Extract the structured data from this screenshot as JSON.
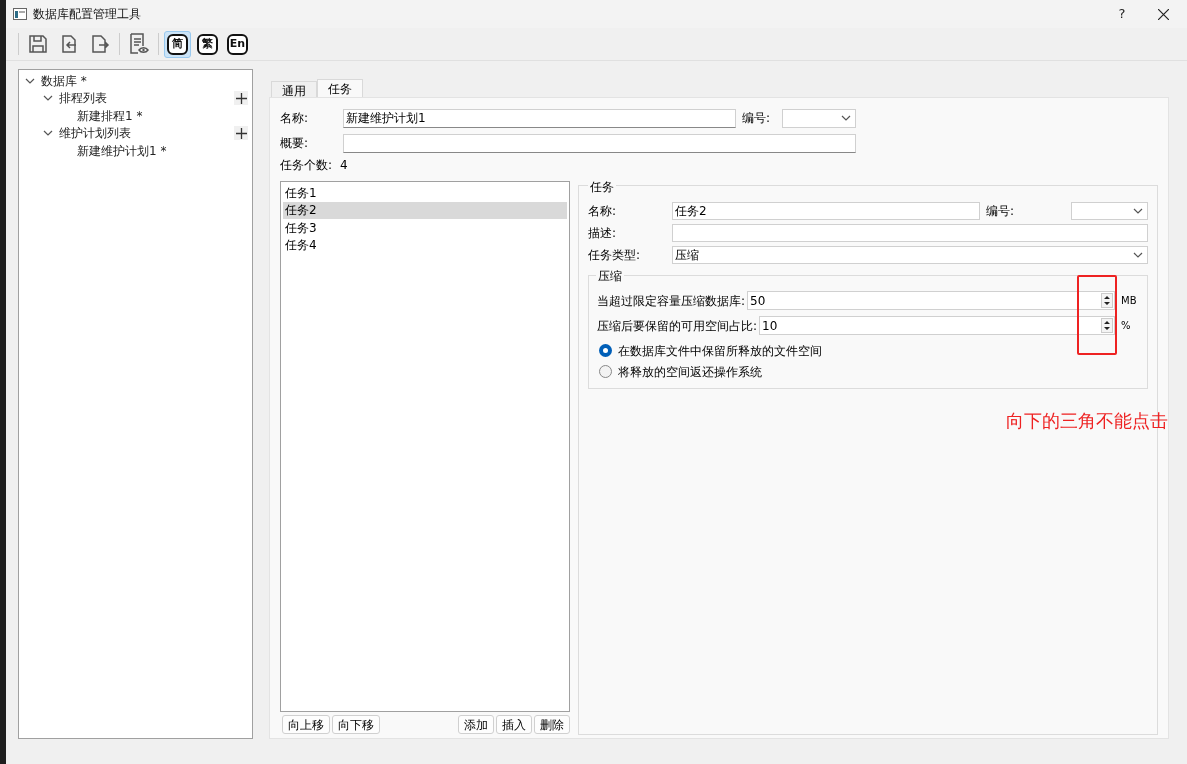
{
  "window": {
    "title": "数据库配置管理工具",
    "help": "?"
  },
  "toolbar": {
    "actions": [
      {
        "kind": "save"
      },
      {
        "kind": "import"
      },
      {
        "kind": "export"
      },
      {
        "kind": "preview"
      }
    ],
    "languages": [
      {
        "label": "简",
        "selected": true
      },
      {
        "label": "繁",
        "selected": false
      },
      {
        "label": "En",
        "selected": false
      }
    ]
  },
  "tree": [
    {
      "label": "数据库 *",
      "expanded": true,
      "addable": false,
      "children": [
        {
          "label": "排程列表",
          "expanded": true,
          "addable": true,
          "children": [
            {
              "label": "新建排程1 *",
              "addable": false
            }
          ]
        },
        {
          "label": "维护计划列表",
          "expanded": true,
          "addable": true,
          "children": [
            {
              "label": "新建维护计划1 *",
              "addable": false
            }
          ]
        }
      ]
    }
  ],
  "tabs": [
    {
      "label": "通用",
      "selected": false
    },
    {
      "label": "任务",
      "selected": true
    }
  ],
  "plan": {
    "name_label": "名称:",
    "name_value": "新建维护计划1",
    "number_label": "编号:",
    "summary_label": "概要:",
    "task_count_label": "任务个数:",
    "task_count": "4"
  },
  "task_list": [
    {
      "label": "任务1",
      "selected": false
    },
    {
      "label": "任务2",
      "selected": true
    },
    {
      "label": "任务3",
      "selected": false
    },
    {
      "label": "任务4",
      "selected": false
    }
  ],
  "list_buttons_left": [
    "向上移",
    "向下移"
  ],
  "list_buttons_right": [
    "添加",
    "插入",
    "删除"
  ],
  "task": {
    "title": "任务",
    "name_label": "名称:",
    "name_value": "任务2",
    "number_label": "编号:",
    "desc_label": "描述:",
    "type_label": "任务类型:",
    "type_value": "压缩",
    "compress": {
      "title": "压缩",
      "spins": [
        {
          "label": "当超过限定容量压缩数据库:",
          "value": "50",
          "unit": "MB"
        },
        {
          "label": "压缩后要保留的可用空间占比:",
          "value": "10",
          "unit": "%"
        }
      ],
      "radios": [
        {
          "label": "在数据库文件中保留所释放的文件空间",
          "selected": true
        },
        {
          "label": "将释放的空间返还操作系统",
          "selected": false
        }
      ]
    }
  },
  "annotation": {
    "text": "向下的三角不能点击"
  }
}
